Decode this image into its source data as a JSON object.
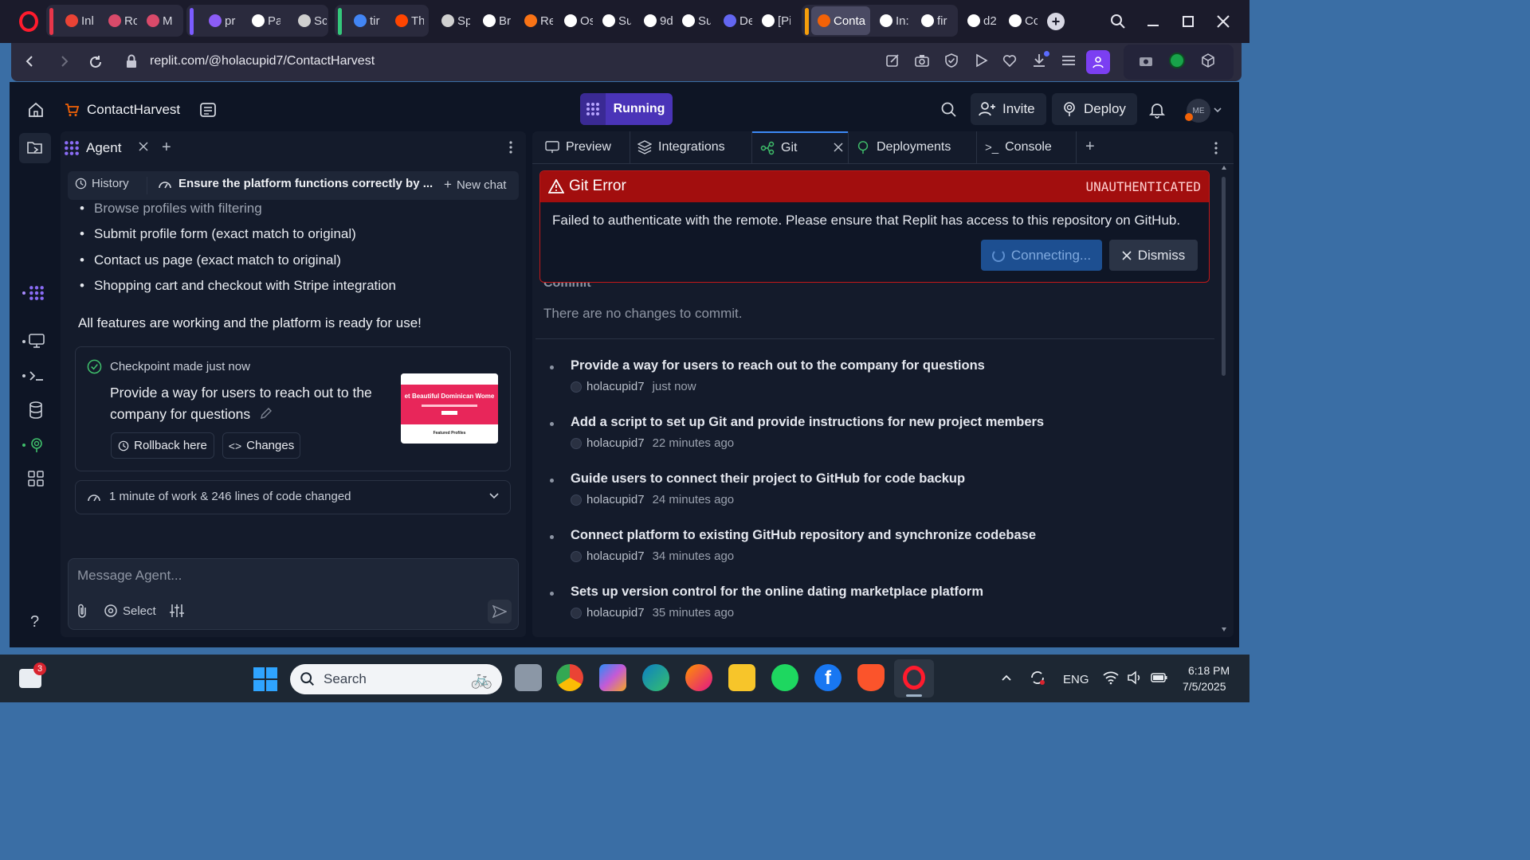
{
  "browser": {
    "tabs": [
      {
        "label": "Inl",
        "color": "#ea4335"
      },
      {
        "label": "Ro",
        "color": "#d94a6a"
      },
      {
        "label": "M",
        "color": "#d94a6a"
      },
      {
        "label": "pr",
        "color": "#8b5cf6"
      },
      {
        "label": "Pa",
        "color": "#ffffff"
      },
      {
        "label": "Sc",
        "color": "#cfcfcf"
      },
      {
        "label": "tir",
        "color": "#4285f4"
      },
      {
        "label": "Th",
        "color": "#ff4500"
      },
      {
        "label": "Sp",
        "color": "#d0d0d0"
      },
      {
        "label": "Br",
        "color": "#ffffff"
      },
      {
        "label": "Re",
        "color": "#f97316"
      },
      {
        "label": "Os",
        "color": "#ffffff"
      },
      {
        "label": "Su",
        "color": "#ffffff"
      },
      {
        "label": "9d",
        "color": "#ffffff"
      },
      {
        "label": "Su",
        "color": "#ffffff"
      },
      {
        "label": "De",
        "color": "#6366f1"
      },
      {
        "label": "[Pi",
        "color": "#ffffff"
      },
      {
        "label": "Conta",
        "color": "#f26207"
      },
      {
        "label": "In:",
        "color": "#ffffff"
      },
      {
        "label": "fir",
        "color": "#ffffff"
      },
      {
        "label": "d2",
        "color": "#ffffff"
      },
      {
        "label": "Cc",
        "color": "#ffffff"
      }
    ],
    "url": "replit.com/@holacupid7/ContactHarvest"
  },
  "app": {
    "project_name": "ContactHarvest",
    "run_status": "Running",
    "invite_label": "Invite",
    "deploy_label": "Deploy",
    "avatar_initials": "ME"
  },
  "agent": {
    "tab_label": "Agent",
    "history_label": "History",
    "chat_title": "Ensure the platform functions correctly by ...",
    "new_chat_label": "New chat",
    "bullets": [
      "Browse profiles with filtering",
      "Submit profile form (exact match to original)",
      "Contact us page (exact match to original)",
      "Shopping cart and checkout with Stripe integration"
    ],
    "summary": "All features are working and the platform is ready for use!",
    "checkpoint": {
      "status": "Checkpoint made just now",
      "title": "Provide a way for users to reach out to the company for questions",
      "rollback_label": "Rollback here",
      "changes_label": "Changes",
      "thumb_banner": "et Beautiful Dominican Wome",
      "thumb_footer": "Featured Profiles"
    },
    "work_summary": "1 minute of work & 246 lines of code changed",
    "input_placeholder": "Message Agent...",
    "select_label": "Select"
  },
  "right_tabs": [
    {
      "label": "Preview"
    },
    {
      "label": "Integrations"
    },
    {
      "label": "Git"
    },
    {
      "label": "Deployments"
    },
    {
      "label": "Console"
    }
  ],
  "git_error": {
    "title": "Git Error",
    "code": "UNAUTHENTICATED",
    "message": "Failed to authenticate with the remote. Please ensure that Replit has access to this repository on GitHub.",
    "connecting_label": "Connecting...",
    "dismiss_label": "Dismiss"
  },
  "git": {
    "commit_heading": "Commit",
    "no_changes": "There are no changes to commit.",
    "commits": [
      {
        "title": "Provide a way for users to reach out to the company for questions",
        "author": "holacupid7",
        "time": "just now"
      },
      {
        "title": "Add a script to set up Git and provide instructions for new project members",
        "author": "holacupid7",
        "time": "22 minutes ago"
      },
      {
        "title": "Guide users to connect their project to GitHub for code backup",
        "author": "holacupid7",
        "time": "24 minutes ago"
      },
      {
        "title": "Connect platform to existing GitHub repository and synchronize codebase",
        "author": "holacupid7",
        "time": "34 minutes ago"
      },
      {
        "title": "Sets up version control for the online dating marketplace platform",
        "author": "holacupid7",
        "time": "35 minutes ago"
      }
    ]
  },
  "taskbar": {
    "search_placeholder": "Search",
    "language": "ENG",
    "time": "6:18 PM",
    "date": "7/5/2025",
    "notification_count": "3"
  },
  "colors": {
    "error_red": "#a20e0e",
    "running_purple": "#5b3fd6",
    "connecting_blue": "#1d4f91"
  }
}
